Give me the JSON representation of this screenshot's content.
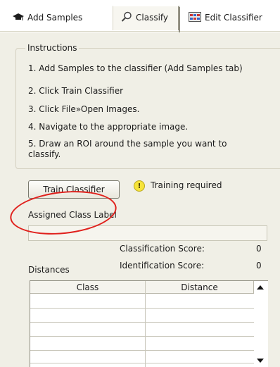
{
  "tabs": {
    "add_samples": "Add Samples",
    "classify": "Classify",
    "edit_classifier": "Edit Classifier"
  },
  "instructions": {
    "legend": "Instructions",
    "steps": [
      "1. Add Samples to the classifier (Add Samples tab)",
      "2. Click Train Classifier",
      "3. Click File»Open Images.",
      "4. Navigate to the appropriate image.",
      "5. Draw an ROI around the sample you want to",
      "classify."
    ]
  },
  "train": {
    "button_label": "Train Classifier",
    "status_icon": "warning-icon",
    "status_text": "Training required"
  },
  "assigned": {
    "label": "Assigned Class Label",
    "value": ""
  },
  "scores": {
    "classification_label": "Classification Score:",
    "classification_value": "0",
    "identification_label": "Identification Score:",
    "identification_value": "0"
  },
  "distances": {
    "label": "Distances",
    "columns": [
      "Class",
      "Distance"
    ]
  },
  "colors": {
    "annotation": "#e0201c",
    "warning": "#f6e33a"
  }
}
